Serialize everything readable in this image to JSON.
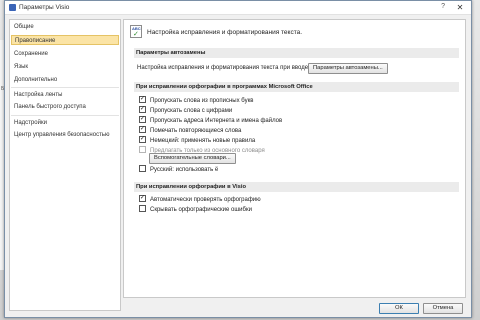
{
  "window": {
    "title": "Параметры Visio",
    "help_glyph": "?",
    "close_glyph": "✕"
  },
  "background": {
    "side_text": "Буф"
  },
  "sidebar": {
    "items": [
      {
        "label": "Общие"
      },
      {
        "label": "Правописание",
        "selected": true
      },
      {
        "label": "Сохранение"
      },
      {
        "label": "Язык"
      },
      {
        "label": "Дополнительно"
      },
      {
        "label": "Настройка ленты"
      },
      {
        "label": "Панель быстрого доступа"
      },
      {
        "label": "Надстройки"
      },
      {
        "label": "Центр управления безопасностью"
      }
    ]
  },
  "content": {
    "header_text": "Настройка исправления и форматирования текста.",
    "header_icon": "abc-check-icon",
    "autocorrect": {
      "section_title": "Параметры автозамены",
      "row_label": "Настройка исправления и форматирования текста при вводе:",
      "button_label": "Параметры автозамены..."
    },
    "office_spelling": {
      "section_title": "При исправлении орфографии в программах Microsoft Office",
      "options": [
        {
          "label": "Пропускать слова из прописных букв",
          "checked": true,
          "disabled": false
        },
        {
          "label": "Пропускать слова с цифрами",
          "checked": true,
          "disabled": false
        },
        {
          "label": "Пропускать адреса Интернета и имена файлов",
          "checked": true,
          "disabled": false
        },
        {
          "label": "Помечать повторяющиеся слова",
          "checked": true,
          "disabled": false
        },
        {
          "label": "Немецкий: применять новые правила",
          "checked": true,
          "disabled": false
        },
        {
          "label": "Предлагать только из основного словаря",
          "checked": false,
          "disabled": true
        }
      ],
      "custom_dict_button": "Вспомогательные словари...",
      "russian_option": {
        "label": "Русский: использовать ё",
        "checked": false
      }
    },
    "visio_spelling": {
      "section_title": "При исправлении орфографии в Visio",
      "options": [
        {
          "label": "Автоматически проверять орфографию",
          "checked": true
        },
        {
          "label": "Скрывать орфографические ошибки",
          "checked": false
        }
      ]
    }
  },
  "buttons": {
    "ok": "ОК",
    "cancel": "Отмена"
  },
  "colors": {
    "selected_bg": "#fbe4a6",
    "section_bg": "#ebebeb",
    "accent": "#3a64b7"
  }
}
